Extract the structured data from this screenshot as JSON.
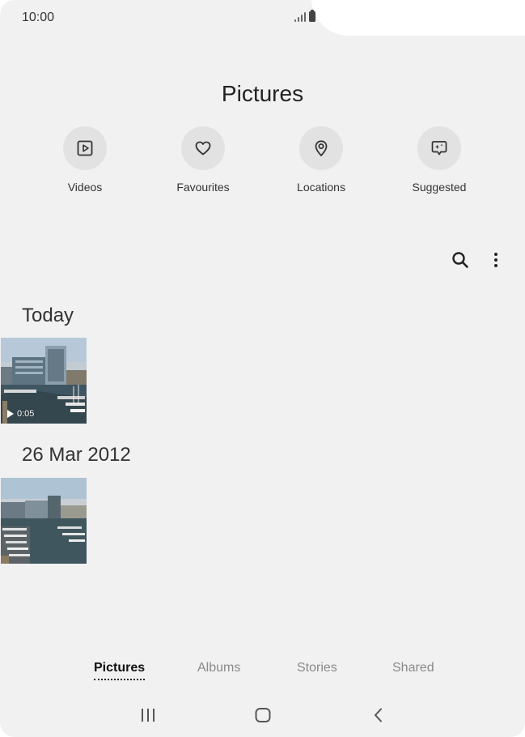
{
  "status_bar": {
    "time": "10:00"
  },
  "header": {
    "title": "Pictures"
  },
  "shortcuts": [
    {
      "label": "Videos",
      "icon": "video-play-icon"
    },
    {
      "label": "Favourites",
      "icon": "heart-icon"
    },
    {
      "label": "Locations",
      "icon": "location-pin-icon"
    },
    {
      "label": "Suggested",
      "icon": "sparkle-message-icon"
    }
  ],
  "toolbar": {
    "search_icon": "search-icon",
    "more_icon": "more-vertical-icon"
  },
  "sections": [
    {
      "date": "Today",
      "items": [
        {
          "type": "video",
          "duration": "0:05"
        }
      ]
    },
    {
      "date": "26 Mar 2012",
      "items": [
        {
          "type": "image"
        }
      ]
    }
  ],
  "bottom_tabs": [
    {
      "label": "Pictures",
      "active": true
    },
    {
      "label": "Albums",
      "active": false
    },
    {
      "label": "Stories",
      "active": false
    },
    {
      "label": "Shared",
      "active": false
    }
  ],
  "nav": {
    "recents": "recents-icon",
    "home": "home-icon",
    "back": "back-icon"
  },
  "colors": {
    "background": "#f1f1f1",
    "icon_circle": "#e2e2e2",
    "active_tab": "#111111",
    "inactive_tab": "#8a8a8a"
  }
}
